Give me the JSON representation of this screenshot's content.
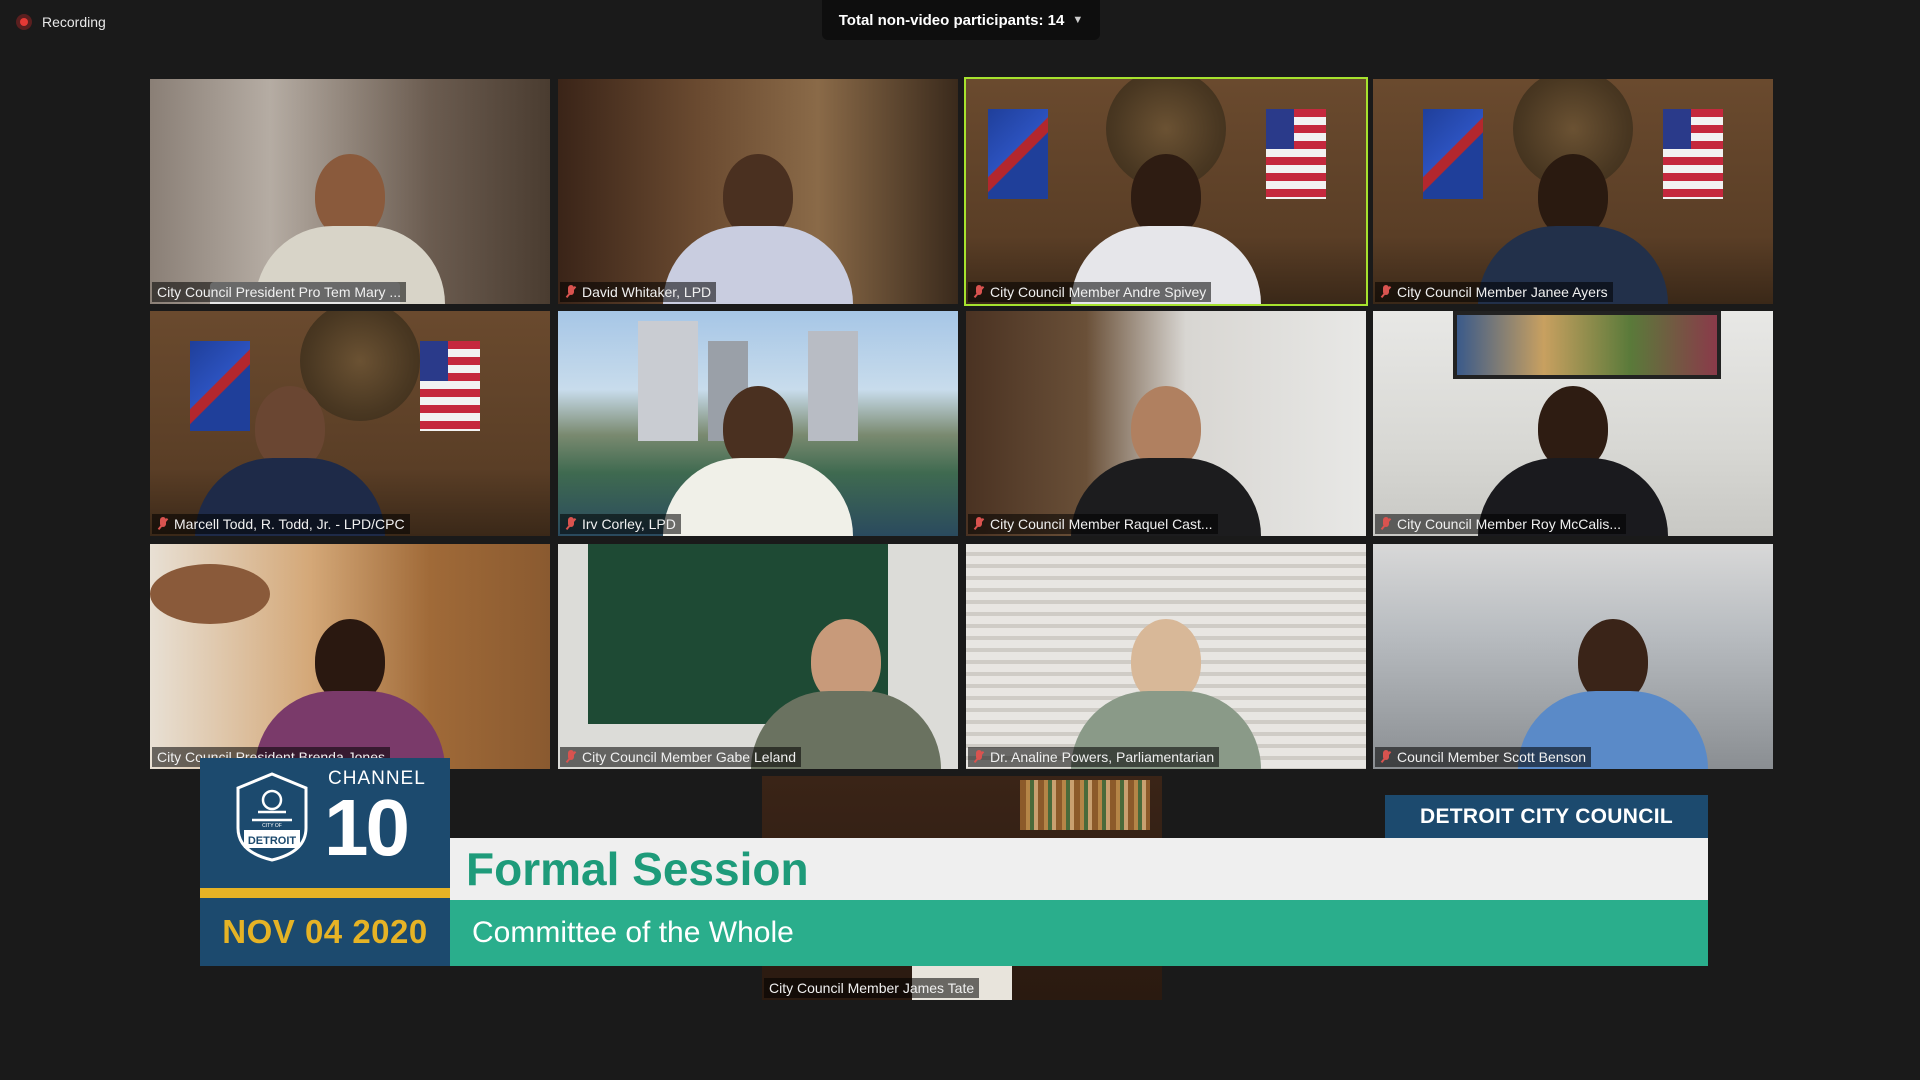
{
  "recording": {
    "label": "Recording"
  },
  "participants": {
    "label": "Total non-video participants: 14"
  },
  "tiles": [
    {
      "name": "City Council President Pro Tem Mary ...",
      "muted": false
    },
    {
      "name": "David Whitaker, LPD",
      "muted": true
    },
    {
      "name": "City Council Member Andre Spivey",
      "muted": true
    },
    {
      "name": "City Council Member Janee Ayers",
      "muted": true
    },
    {
      "name": "Marcell Todd, R. Todd, Jr. - LPD/CPC",
      "muted": true
    },
    {
      "name": "Irv Corley, LPD",
      "muted": true
    },
    {
      "name": "City Council Member Raquel Cast...",
      "muted": true
    },
    {
      "name": "City Council Member Roy McCalis...",
      "muted": true
    },
    {
      "name": "City Council President Brenda Jones",
      "muted": false
    },
    {
      "name": "City Council Member Gabe Leland",
      "muted": true
    },
    {
      "name": "Dr. Analine Powers, Parliamentarian",
      "muted": true
    },
    {
      "name": "Council Member Scott Benson",
      "muted": true
    }
  ],
  "featured": {
    "name": "City Council Member James Tate"
  },
  "broadcast": {
    "channel_label": "CHANNEL",
    "channel_number": "10",
    "logo_text": "CITY OF DETROIT",
    "date": "NOV 04 2020",
    "org": "DETROIT CITY COUNCIL",
    "title": "Formal Session",
    "subtitle": "Committee of the Whole"
  }
}
